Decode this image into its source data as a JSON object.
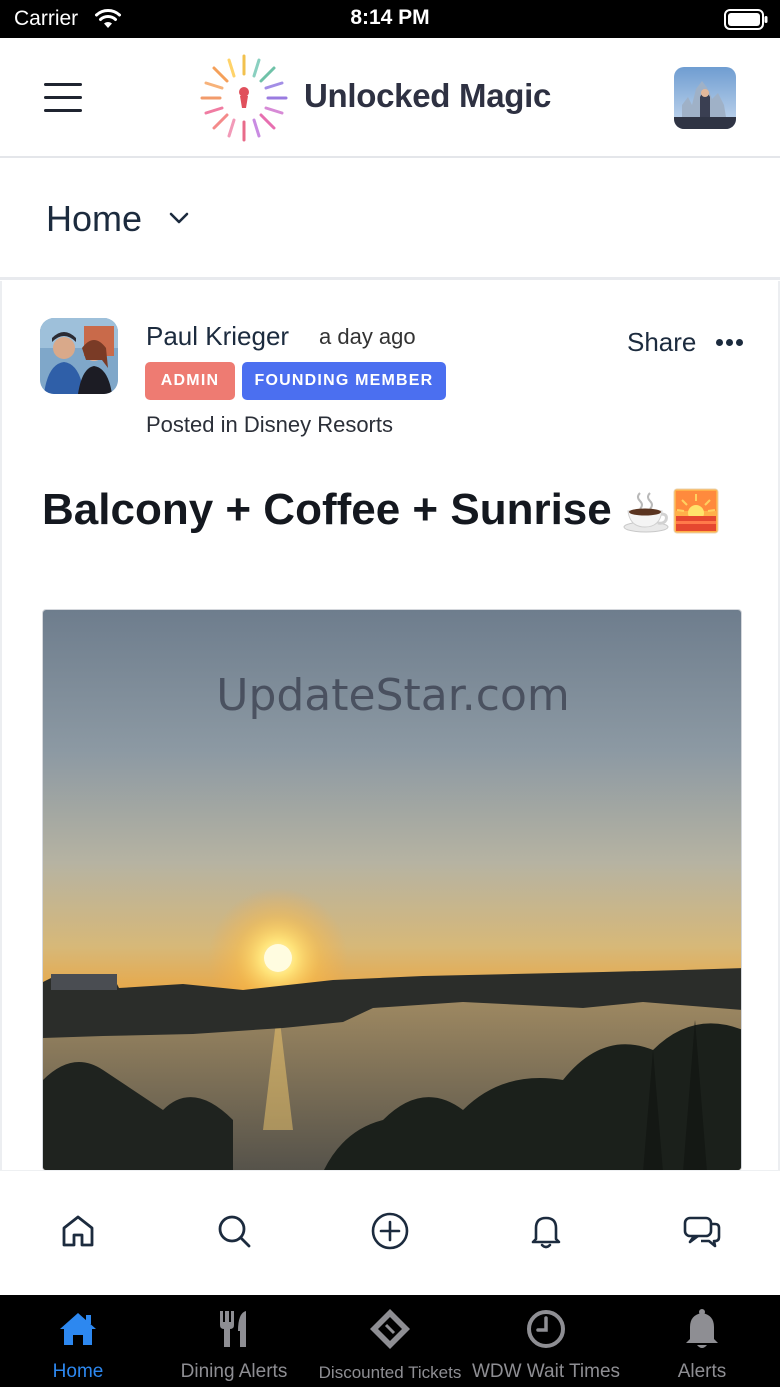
{
  "status_bar": {
    "carrier": "Carrier",
    "time": "8:14 PM"
  },
  "header": {
    "logo_text": "Unlocked Magic"
  },
  "page": {
    "title": "Home"
  },
  "post": {
    "author": "Paul Krieger",
    "time_ago": "a day ago",
    "badges": [
      "ADMIN",
      "FOUNDING MEMBER"
    ],
    "posted_in": "Posted in Disney Resorts",
    "share_label": "Share",
    "title": "Balcony + Coffee + Sunrise",
    "watermark": "UpdateStar.com"
  },
  "community_nav": [
    "home-icon",
    "search-icon",
    "add-circle-icon",
    "bell-icon",
    "chat-icon"
  ],
  "tabs": [
    {
      "label": "Home",
      "icon": "house-icon",
      "active": true
    },
    {
      "label": "Dining Alerts",
      "icon": "fork-knife-icon",
      "active": false
    },
    {
      "label": "Discounted Tickets",
      "icon": "ticket-icon",
      "active": false
    },
    {
      "label": "WDW Wait Times",
      "icon": "clock-icon",
      "active": false
    },
    {
      "label": "Alerts",
      "icon": "bell-icon",
      "active": false
    }
  ],
  "colors": {
    "admin_badge": "#ee7b72",
    "founding_badge": "#4b6ff0",
    "active_tab": "#2d88f0",
    "inactive_tab": "#8e8e93"
  }
}
